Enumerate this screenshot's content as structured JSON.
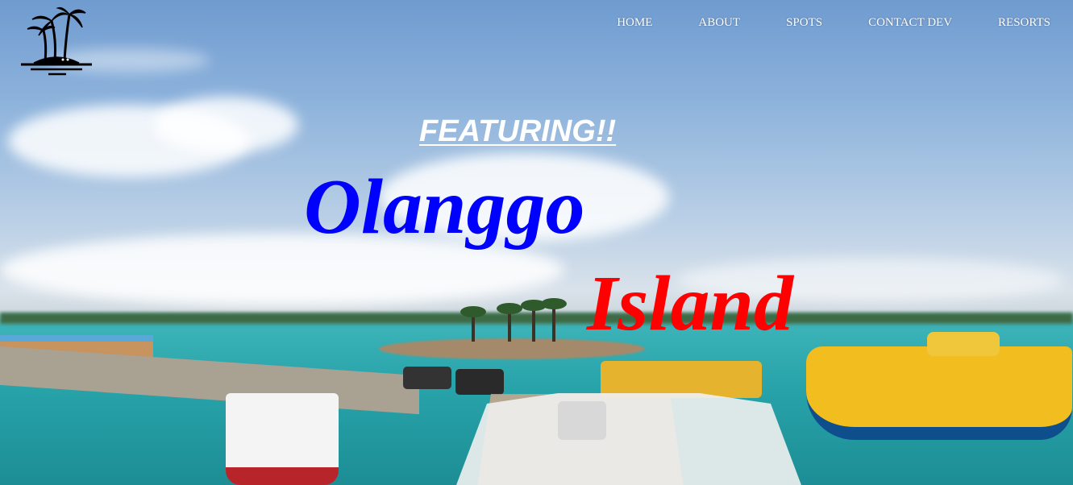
{
  "nav": {
    "items": [
      {
        "label": "HOME"
      },
      {
        "label": "ABOUT"
      },
      {
        "label": "SPOTS"
      },
      {
        "label": "CONTACT DEV"
      },
      {
        "label": "RESORTS"
      }
    ]
  },
  "logo": {
    "icon": "palm-island-icon"
  },
  "hero": {
    "kicker": "FEATURING!!",
    "title_line1": "Olanggo",
    "title_line2": "Island",
    "title_line1_color": "#0000ff",
    "title_line2_color": "#ff0000",
    "kicker_color": "#ffffff"
  }
}
